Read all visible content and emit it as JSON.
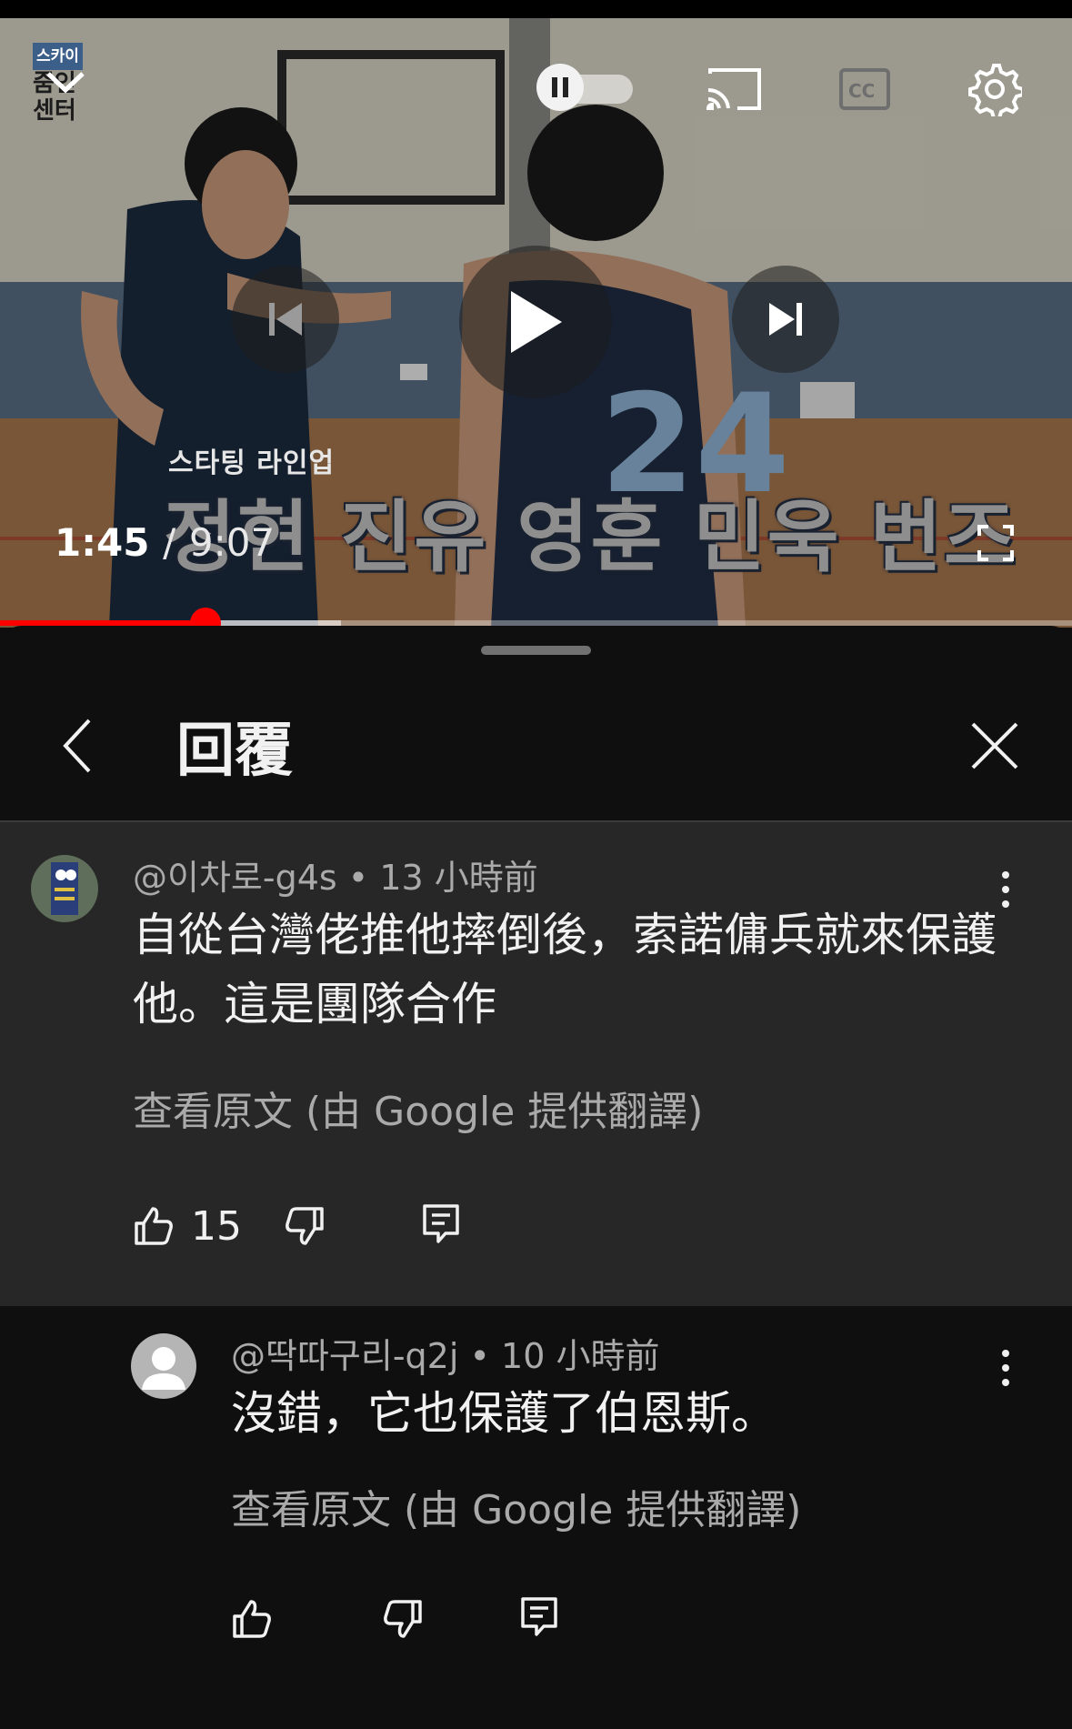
{
  "player": {
    "current_time": "1:45",
    "time_separator": "/",
    "duration": "9:07",
    "progress_fraction": 0.192,
    "overlay_subtitle": "스타팅 라인업",
    "overlay_title": "정현 진유 영훈 민욱 번즈",
    "watermark_top": "스카이",
    "watermark_line1": "줌인",
    "watermark_line2": "센터",
    "jersey_number": "24",
    "icons": {
      "collapse": "chevron-down-icon",
      "autoplay": "pause-toggle-icon",
      "cast": "cast-icon",
      "captions": "cc-icon",
      "settings": "gear-icon",
      "previous": "previous-icon",
      "play": "play-icon",
      "next": "next-icon",
      "fullscreen": "fullscreen-icon"
    },
    "colors": {
      "progress": "#ff0000"
    }
  },
  "sheet": {
    "title": "回覆",
    "back_icon": "back-icon",
    "close_icon": "close-icon"
  },
  "comments": [
    {
      "author": "@이차로-g4s",
      "separator": "•",
      "time": "13 小時前",
      "text": "自從台灣佬推他摔倒後，索諾傭兵就來保護他。這是團隊合作",
      "translate_link": "查看原文 (由 Google 提供翻譯)",
      "likes": "15"
    },
    {
      "author": "@딱따구리-q2j",
      "separator": "•",
      "time": "10 小時前",
      "text": "沒錯，它也保護了伯恩斯。",
      "translate_link": "查看原文 (由 Google 提供翻譯)",
      "likes": ""
    }
  ]
}
